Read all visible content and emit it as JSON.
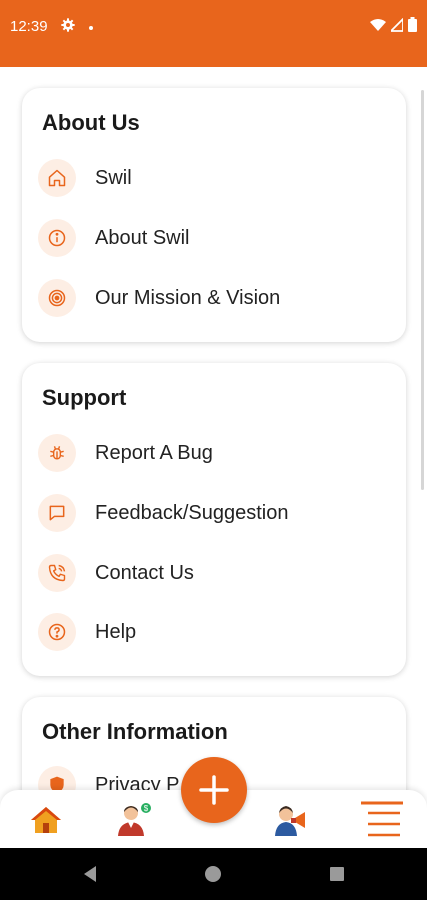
{
  "status_bar": {
    "time": "12:39"
  },
  "about": {
    "title": "About Us",
    "items": [
      {
        "label": "Swil",
        "icon": "home-icon"
      },
      {
        "label": "About Swil",
        "icon": "info-icon"
      },
      {
        "label": "Our Mission & Vision",
        "icon": "target-icon"
      }
    ]
  },
  "support": {
    "title": "Support",
    "items": [
      {
        "label": "Report A Bug",
        "icon": "bug-icon"
      },
      {
        "label": "Feedback/Suggestion",
        "icon": "chat-icon"
      },
      {
        "label": "Contact Us",
        "icon": "phone-icon"
      },
      {
        "label": "Help",
        "icon": "help-icon"
      }
    ]
  },
  "other": {
    "title": "Other Information",
    "items": [
      {
        "label": "Privacy P",
        "icon": "shield-icon"
      }
    ]
  },
  "bottom_nav": {
    "items": [
      "home-icon",
      "user-dashboard-icon",
      "add-icon",
      "announcement-icon",
      "menu-icon"
    ]
  },
  "colors": {
    "accent": "#e8651c",
    "icon_bg": "#fdeee4"
  }
}
